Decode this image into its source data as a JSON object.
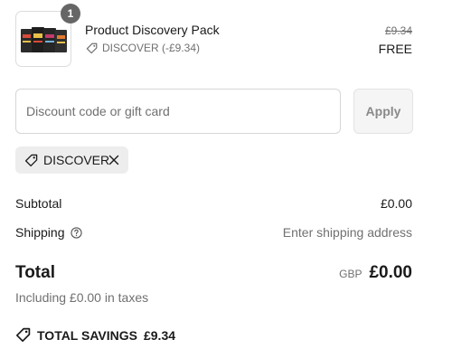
{
  "product": {
    "name": "Product Discovery Pack",
    "quantity": "1",
    "discount_text": "DISCOVER (-£9.34)",
    "original_price": "£9.34",
    "price": "FREE",
    "image_icon": "product-pack-image"
  },
  "discount_form": {
    "placeholder": "Discount code or gift card",
    "value": "",
    "apply_label": "Apply"
  },
  "applied_code": {
    "label": "DISCOVER",
    "tag_icon": "tag-icon",
    "remove_icon": "close-icon"
  },
  "summary": {
    "subtotal_label": "Subtotal",
    "subtotal_value": "£0.00",
    "shipping_label": "Shipping",
    "shipping_help_icon": "question-circle-icon",
    "shipping_value": "Enter shipping address",
    "total_label": "Total",
    "currency": "GBP",
    "total_value": "£0.00",
    "taxes_note": "Including £0.00 in taxes",
    "savings_label": "TOTAL SAVINGS",
    "savings_value": "£9.34"
  },
  "colors": {
    "text": "#1a1a1a",
    "muted_text": "#707070",
    "badge": "#666666",
    "chip_bg": "#ededed",
    "button_bg": "#f5f5f5",
    "border": "#d6d6d6"
  }
}
